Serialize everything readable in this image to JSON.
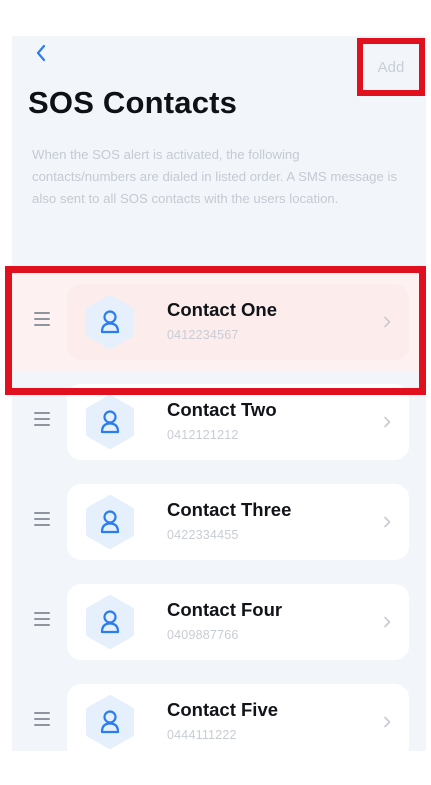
{
  "nav": {
    "back_icon": "chevron-left-icon",
    "add_label": "Add"
  },
  "page": {
    "title": "SOS Contacts",
    "description": "When the SOS alert is activated, the following contacts/numbers are dialed in listed order. A SMS message is also sent to all SOS contacts with the users location."
  },
  "contacts": [
    {
      "name": "Contact One",
      "phone": "0412234567"
    },
    {
      "name": "Contact Two",
      "phone": "0412121212"
    },
    {
      "name": "Contact Three",
      "phone": "0422334455"
    },
    {
      "name": "Contact Four",
      "phone": "0409887766"
    },
    {
      "name": "Contact Five",
      "phone": "0444111222"
    }
  ],
  "colors": {
    "accent": "#2a7cf2",
    "highlight": "#e0101e",
    "avatar_bg": "#e6f0fc"
  },
  "icons": {
    "drag": "drag-handle-icon",
    "avatar": "person-icon",
    "row_arrow": "chevron-right-icon"
  }
}
